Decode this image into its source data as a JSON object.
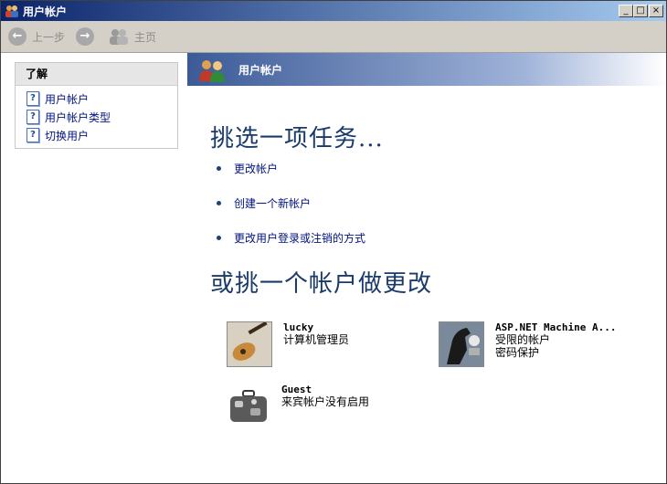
{
  "window": {
    "title": "用户帐户",
    "minimize": "_",
    "maximize": "□",
    "close": "×"
  },
  "toolbar": {
    "back_label": "上一步",
    "home_label": "主页"
  },
  "sidebar": {
    "header": "了解",
    "items": [
      {
        "label": "用户帐户"
      },
      {
        "label": "用户帐户类型"
      },
      {
        "label": "切换用户"
      }
    ]
  },
  "banner": {
    "title": "用户帐户"
  },
  "main": {
    "task_heading": "挑选一项任务...",
    "tasks": [
      {
        "label": "更改帐户"
      },
      {
        "label": "创建一个新帐户"
      },
      {
        "label": "更改用户登录或注销的方式"
      }
    ],
    "account_heading": "或挑一个帐户做更改",
    "accounts": [
      {
        "name": "lucky",
        "lines": [
          "计算机管理员"
        ],
        "icon": "guitar-icon"
      },
      {
        "name": "ASP.NET Machine A...",
        "lines": [
          "受限的帐户",
          "密码保护"
        ],
        "icon": "horse-icon"
      },
      {
        "name": "Guest",
        "lines": [
          "来宾帐户没有启用"
        ],
        "icon": "suitcase-icon"
      }
    ]
  },
  "colors": {
    "link": "#00137f",
    "heading": "#1a3a6a",
    "titlebar": "#0a246a"
  }
}
